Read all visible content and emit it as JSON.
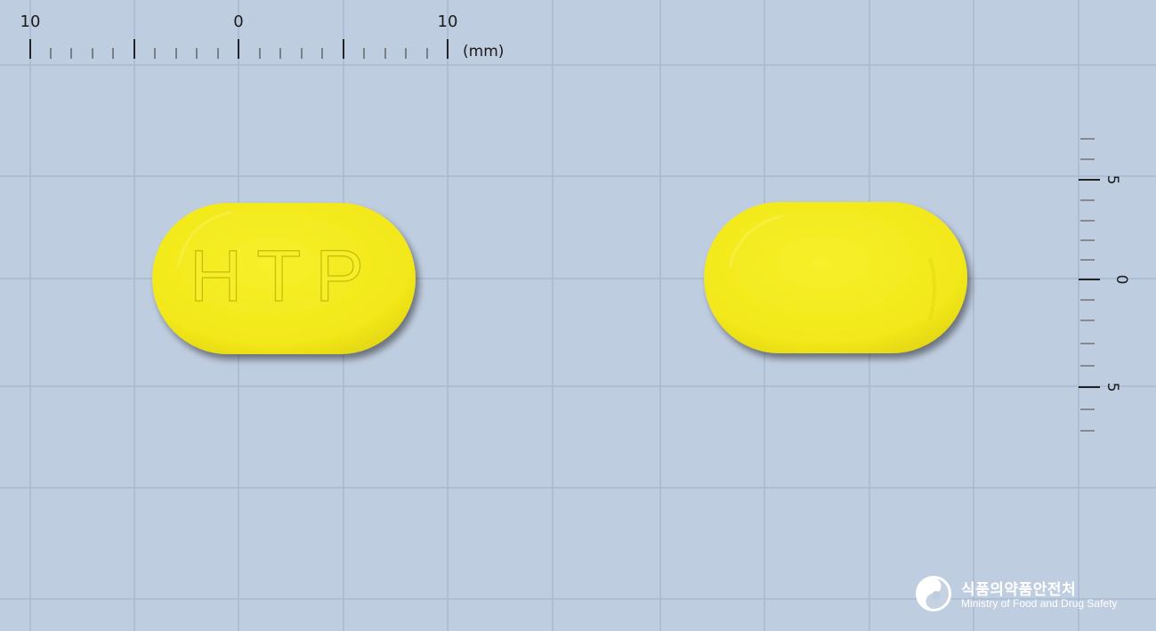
{
  "ruler_top": {
    "labels": [
      "10",
      "0",
      "10"
    ],
    "unit": "(mm)"
  },
  "ruler_right": {
    "labels": [
      "5",
      "0",
      "5"
    ]
  },
  "pill_front": {
    "imprint": "HTP",
    "color": "#f5ec1c"
  },
  "pill_back": {
    "imprint": "",
    "color": "#f5ec1c"
  },
  "logo": {
    "name_ko": "식품의약품안전처",
    "name_en": "Ministry of Food and Drug Safety",
    "icon": "mfds-emblem-icon"
  },
  "colors": {
    "background": "#bfcde0",
    "grid": "#a6b6cc",
    "pill": "#f5ec1c"
  }
}
